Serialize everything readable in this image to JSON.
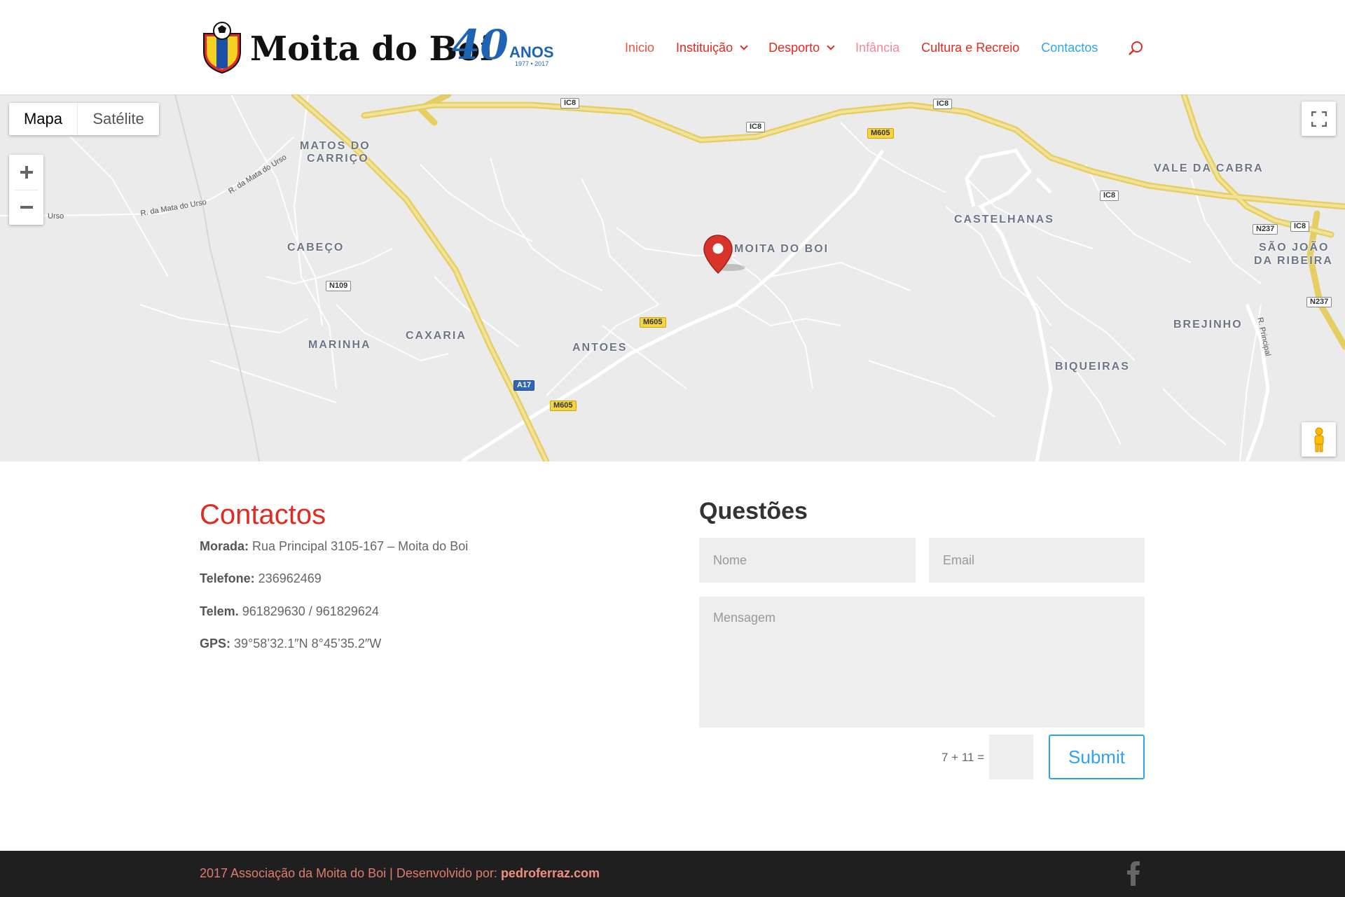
{
  "header": {
    "logo_text": "Moita do Boi",
    "logo_anniversary": "40",
    "logo_anos": "ANOS",
    "logo_years": "1977 • 2017",
    "nav": [
      {
        "label": "Inicio",
        "color": "#e8543c"
      },
      {
        "label": "Instituição",
        "color": "#e02b20"
      },
      {
        "label": "Desporto",
        "color": "#e02b20"
      },
      {
        "label": "Infância",
        "color": "#f08a9a"
      },
      {
        "label": "Cultura e Recreio",
        "color": "#e02b20"
      },
      {
        "label": "Contactos",
        "color": "#2ea3f2"
      }
    ],
    "search_icon": "search-icon"
  },
  "map": {
    "type_active": "Mapa",
    "type_other": "Satélite",
    "zoom_in": "+",
    "zoom_out": "−",
    "places": [
      "MATOS DO",
      "CARRIÇO",
      "CABEÇO",
      "MARINHA",
      "CAXARIA",
      "ANTOES",
      "MOITA DO BOI",
      "CASTELHANAS",
      "VALE DA CABRA",
      "SÃO JOÃO",
      "DA RIBEIRA",
      "BREJINHO",
      "BIQUEIRAS"
    ],
    "roads": [
      "IC8",
      "IC8",
      "IC8",
      "IC8",
      "M605",
      "M605",
      "M605",
      "N109",
      "A17",
      "N237",
      "N237",
      "IC8"
    ],
    "streets": [
      "R. da Mata do Urso",
      "R. da Mata do Urso",
      "Urso",
      "R. Principal"
    ]
  },
  "contact": {
    "title": "Contactos",
    "morada_label": "Morada:",
    "morada_value": " Rua Principal 3105-167 – Moita do Boi",
    "telefone_label": "Telefone:",
    "telefone_value": " 236962469",
    "telem_label": "Telem.",
    "telem_value": " 961829630 / 961829624",
    "gps_label": "GPS:",
    "gps_value": " 39°58’32.1″N 8°45’35.2″W"
  },
  "form": {
    "title": "Questões",
    "name_placeholder": "Nome",
    "email_placeholder": "Email",
    "message_placeholder": "Mensagem",
    "captcha_label": "7 + 11 =",
    "submit_label": "Submit"
  },
  "footer": {
    "text": "2017 Associação da Moita do Boi | Desenvolvido por: ",
    "credit": "pedroferraz.com",
    "social_icon": "facebook-icon"
  },
  "colors": {
    "accent_red": "#e02b20",
    "accent_blue": "#2ea3f2",
    "footer_bg": "#1f1f1f"
  }
}
